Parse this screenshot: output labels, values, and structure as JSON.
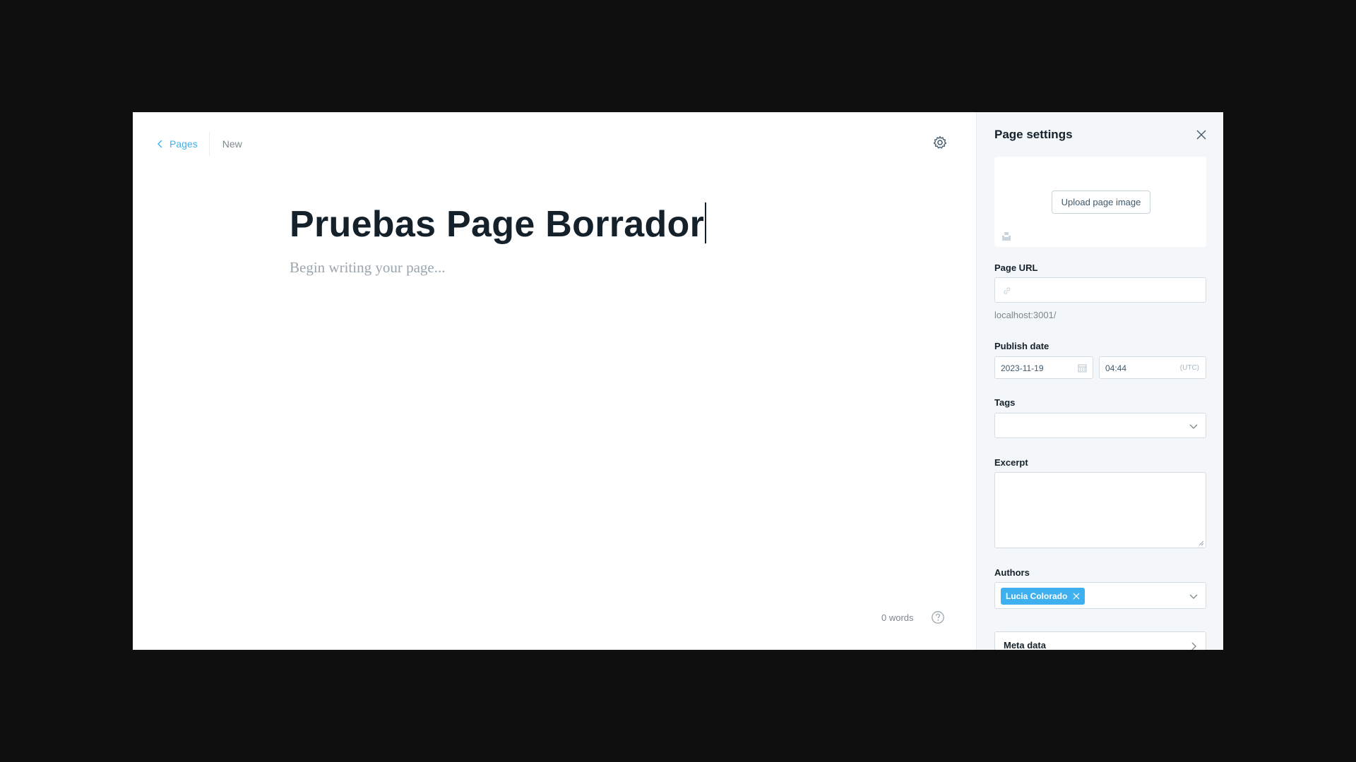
{
  "nav": {
    "back_label": "Pages",
    "status": "New"
  },
  "editor": {
    "title": "Pruebas Page Borrador",
    "body_placeholder": "Begin writing your page...",
    "word_count": "0 words"
  },
  "settings": {
    "title": "Page settings",
    "upload_label": "Upload page image",
    "url_label": "Page URL",
    "url_value": "",
    "url_hint": "localhost:3001/",
    "publish_label": "Publish date",
    "publish_date": "2023-11-19",
    "publish_time": "04:44",
    "timezone": "(UTC)",
    "tags_label": "Tags",
    "excerpt_label": "Excerpt",
    "authors_label": "Authors",
    "authors": [
      "Lucia Colorado"
    ],
    "meta_label": "Meta data"
  },
  "colors": {
    "accent": "#3eb0ef",
    "text": "#15212a",
    "muted": "#7d878a",
    "panel_bg": "#f4f7f9"
  }
}
